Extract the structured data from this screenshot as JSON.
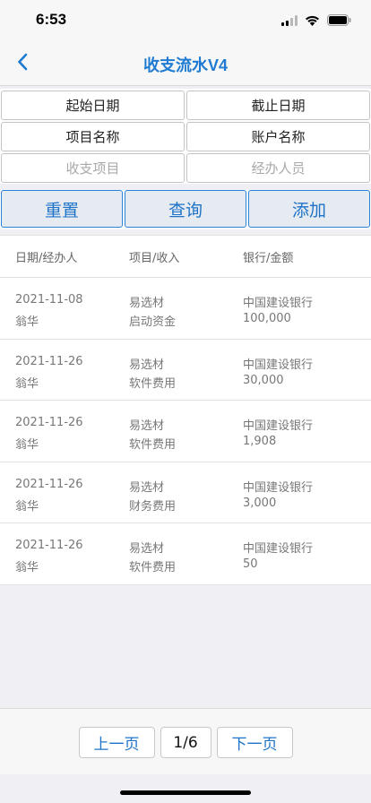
{
  "status_bar": {
    "time": "6:53"
  },
  "nav": {
    "title": "收支流水V4"
  },
  "form": {
    "start_date": "起始日期",
    "end_date": "截止日期",
    "project_name": "项目名称",
    "account_name": "账户名称",
    "income_item_placeholder": "收支项目",
    "handler_placeholder": "经办人员"
  },
  "buttons": {
    "reset": "重置",
    "query": "查询",
    "add": "添加"
  },
  "list": {
    "headers": [
      "日期/经办人",
      "项目/收入",
      "银行/金额"
    ],
    "rows": [
      {
        "date": "2021-11-08",
        "handler": "翁华",
        "project": "易选材",
        "category": "启动资金",
        "bank": "中国建设银行",
        "amount": "100,000"
      },
      {
        "date": "2021-11-26",
        "handler": "翁华",
        "project": "易选材",
        "category": "软件费用",
        "bank": "中国建设银行",
        "amount": "30,000"
      },
      {
        "date": "2021-11-26",
        "handler": "翁华",
        "project": "易选材",
        "category": "软件费用",
        "bank": "中国建设银行",
        "amount": "1,908"
      },
      {
        "date": "2021-11-26",
        "handler": "翁华",
        "project": "易选材",
        "category": "财务费用",
        "bank": "中国建设银行",
        "amount": "3,000"
      },
      {
        "date": "2021-11-26",
        "handler": "翁华",
        "project": "易选材",
        "category": "软件费用",
        "bank": "中国建设银行",
        "amount": "50"
      }
    ]
  },
  "pager": {
    "prev": "上一页",
    "page": "1/6",
    "next": "下一页"
  },
  "colors": {
    "accent": "#1e73c8",
    "background": "#efeff4"
  }
}
